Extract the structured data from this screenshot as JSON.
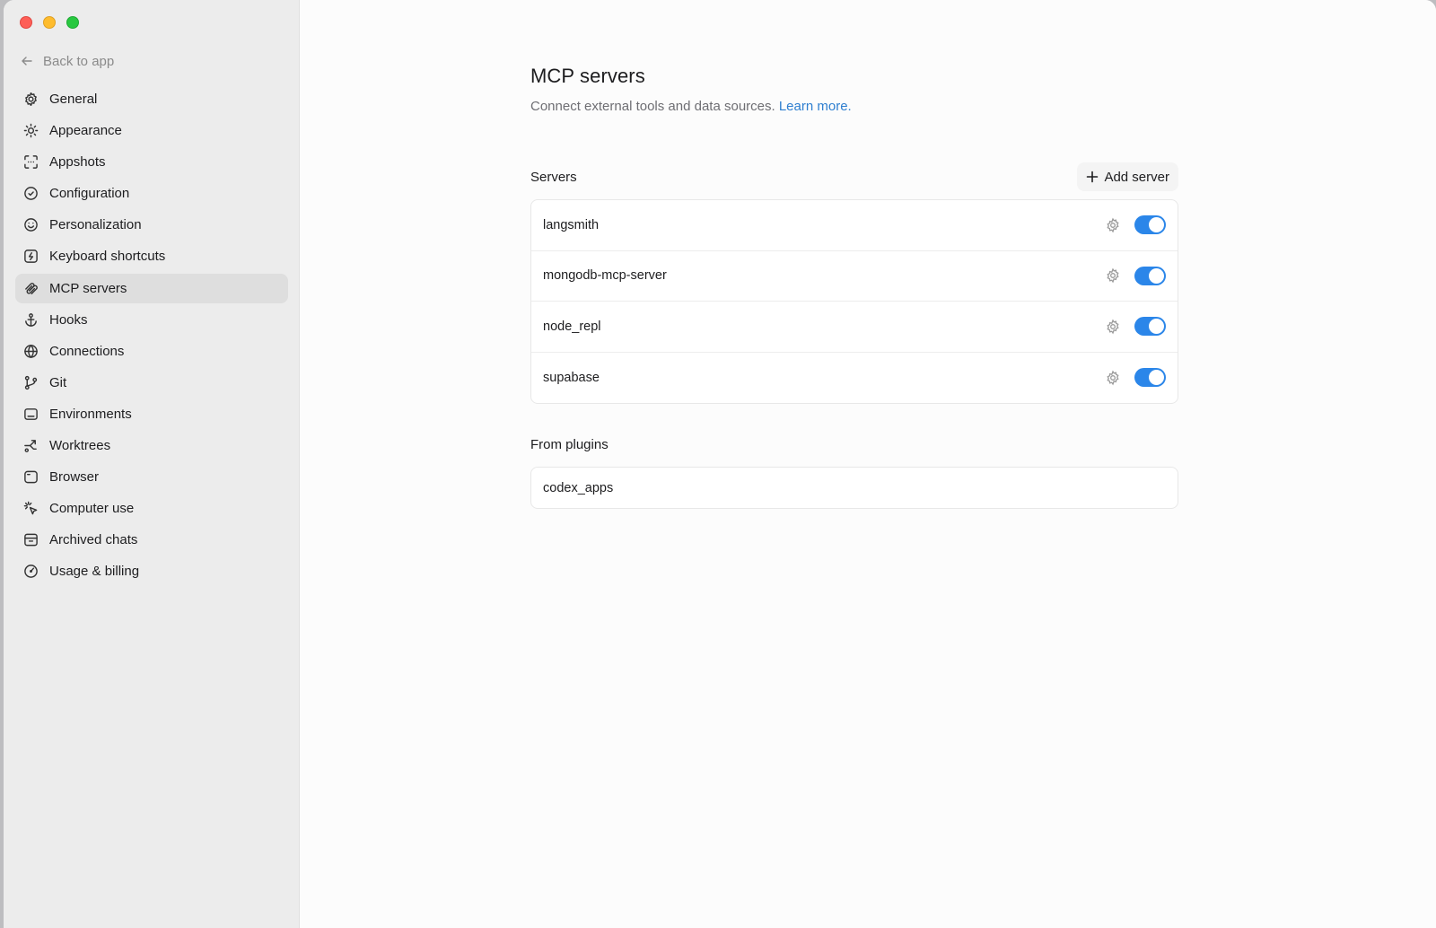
{
  "sidebar": {
    "back_label": "Back to app",
    "items": [
      {
        "label": "General",
        "icon": "gear-icon"
      },
      {
        "label": "Appearance",
        "icon": "sun-icon"
      },
      {
        "label": "Appshots",
        "icon": "screenshot-icon"
      },
      {
        "label": "Configuration",
        "icon": "shield-icon"
      },
      {
        "label": "Personalization",
        "icon": "smile-icon"
      },
      {
        "label": "Keyboard shortcuts",
        "icon": "keyboard-icon"
      },
      {
        "label": "MCP servers",
        "icon": "mcp-icon"
      },
      {
        "label": "Hooks",
        "icon": "anchor-icon"
      },
      {
        "label": "Connections",
        "icon": "globe-icon"
      },
      {
        "label": "Git",
        "icon": "git-branch-icon"
      },
      {
        "label": "Environments",
        "icon": "monitor-icon"
      },
      {
        "label": "Worktrees",
        "icon": "worktree-icon"
      },
      {
        "label": "Browser",
        "icon": "browser-icon"
      },
      {
        "label": "Computer use",
        "icon": "cursor-icon"
      },
      {
        "label": "Archived chats",
        "icon": "archive-icon"
      },
      {
        "label": "Usage & billing",
        "icon": "gauge-icon"
      }
    ],
    "active": "MCP servers"
  },
  "main": {
    "title": "MCP servers",
    "subtitle": "Connect external tools and data sources.",
    "learn_more": "Learn more.",
    "servers_section": {
      "title": "Servers",
      "add_button": "Add server",
      "servers": [
        {
          "name": "langsmith",
          "enabled": true
        },
        {
          "name": "mongodb-mcp-server",
          "enabled": true
        },
        {
          "name": "node_repl",
          "enabled": true
        },
        {
          "name": "supabase",
          "enabled": true
        }
      ]
    },
    "plugins_section": {
      "title": "From plugins",
      "plugins": [
        {
          "name": "codex_apps"
        }
      ]
    }
  },
  "colors": {
    "accent": "#2b86e9",
    "link": "#2f7fd0",
    "sidebar_bg": "#ececec",
    "active_item_bg": "#dedede"
  }
}
